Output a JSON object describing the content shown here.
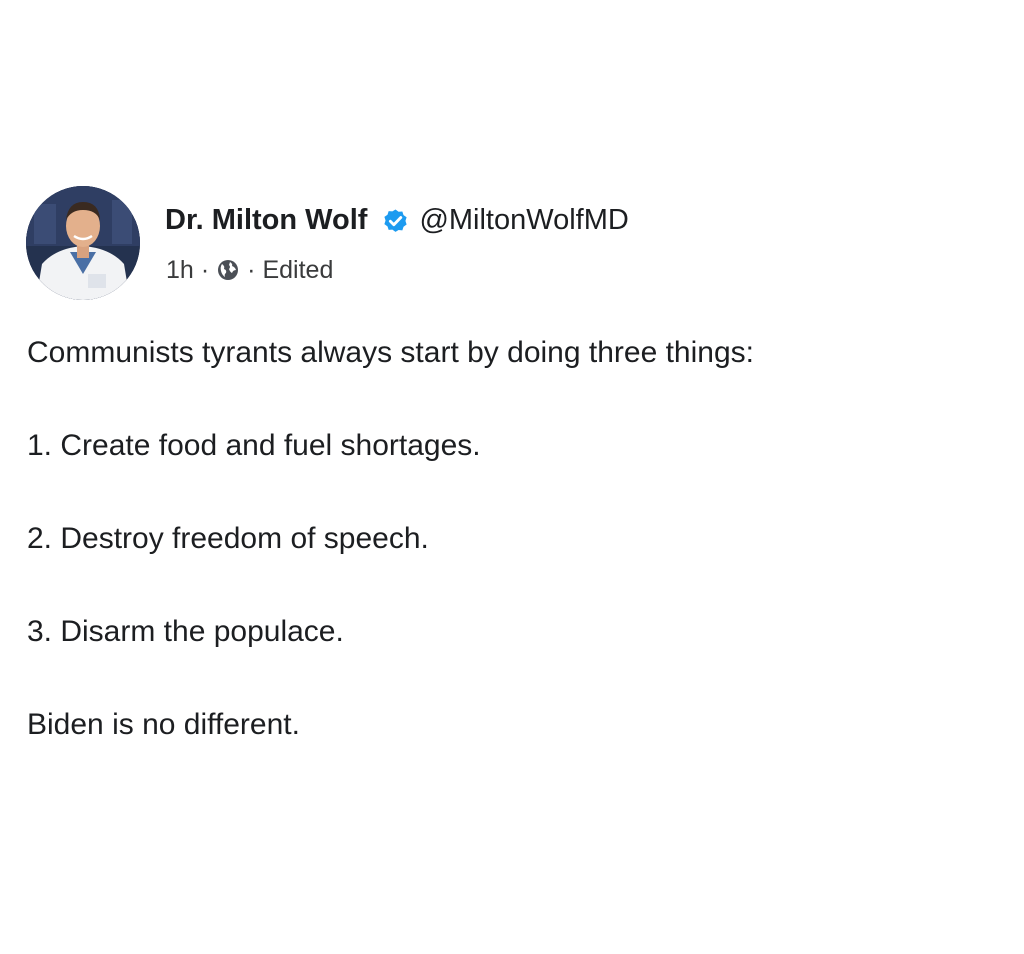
{
  "post": {
    "author_name": "Dr. Milton Wolf",
    "handle": "@MiltonWolfMD",
    "time": "1h",
    "separator": "·",
    "edited_label": "Edited",
    "verified_icon": "verified-badge-icon",
    "audience_icon": "globe-icon",
    "accent_color": "#1d9bf0",
    "paragraphs": [
      "Communists tyrants always start by doing three things:",
      "1. Create food and fuel shortages.",
      "2. Destroy freedom of speech.",
      "3. Disarm the populace.",
      "Biden is no different."
    ]
  }
}
